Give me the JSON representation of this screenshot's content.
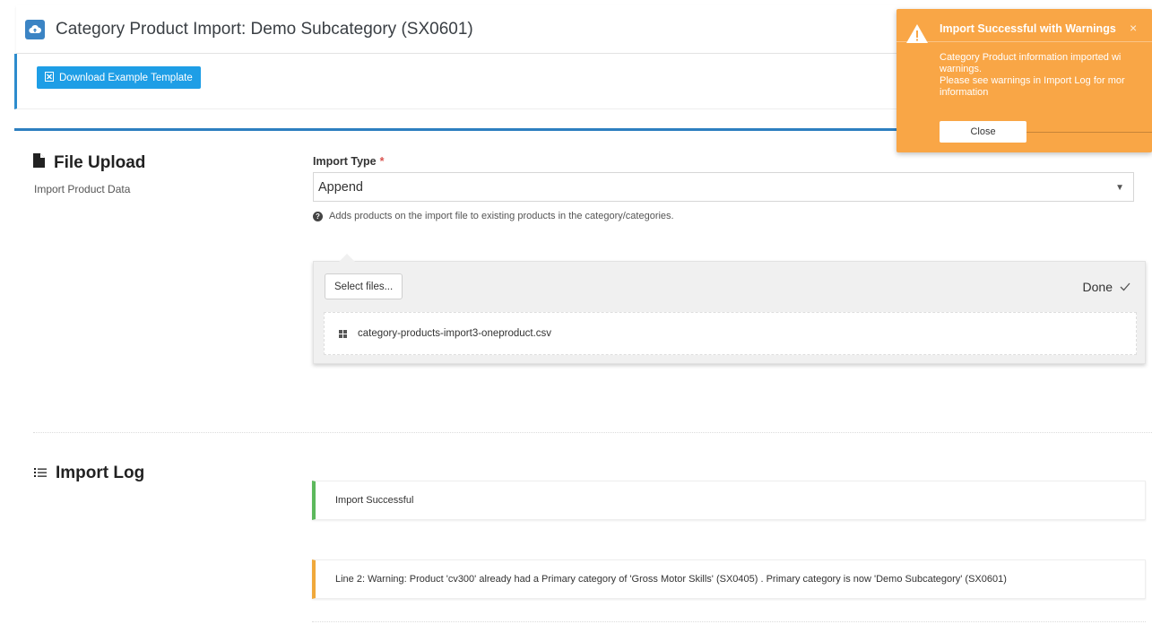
{
  "header": {
    "title": "Category Product Import: Demo Subcategory (SX0601)",
    "icon": "cloud-upload-icon"
  },
  "toolbar": {
    "download_label": "Download Example Template"
  },
  "file_upload": {
    "title": "File Upload",
    "subtitle": "Import Product Data",
    "import_type_label": "Import Type",
    "required_mark": "*",
    "import_type_value": "Append",
    "hint": "Adds products on the import file to existing products in the category/categories.",
    "select_files_label": "Select files...",
    "status": "Done",
    "file_name": "category-products-import3-oneproduct.csv"
  },
  "import_log": {
    "title": "Import Log",
    "entries": [
      {
        "type": "success",
        "message": "Import Successful"
      },
      {
        "type": "warning",
        "message": "Line 2: Warning: Product 'cv300' already had a Primary category of 'Gross Motor Skills' (SX0405) . Primary category is now 'Demo Subcategory' (SX0601)"
      }
    ]
  },
  "toast": {
    "title": "Import Successful with Warnings",
    "body_lines": [
      "Category Product information imported wi",
      "warnings.",
      "Please see warnings in Import Log for mor",
      "information"
    ],
    "close_label": "Close"
  },
  "colors": {
    "accent": "#2d8ccd",
    "button": "#1e9ee6",
    "success": "#5cb85c",
    "warning": "#f0a83b",
    "toast": "#f9a646"
  }
}
